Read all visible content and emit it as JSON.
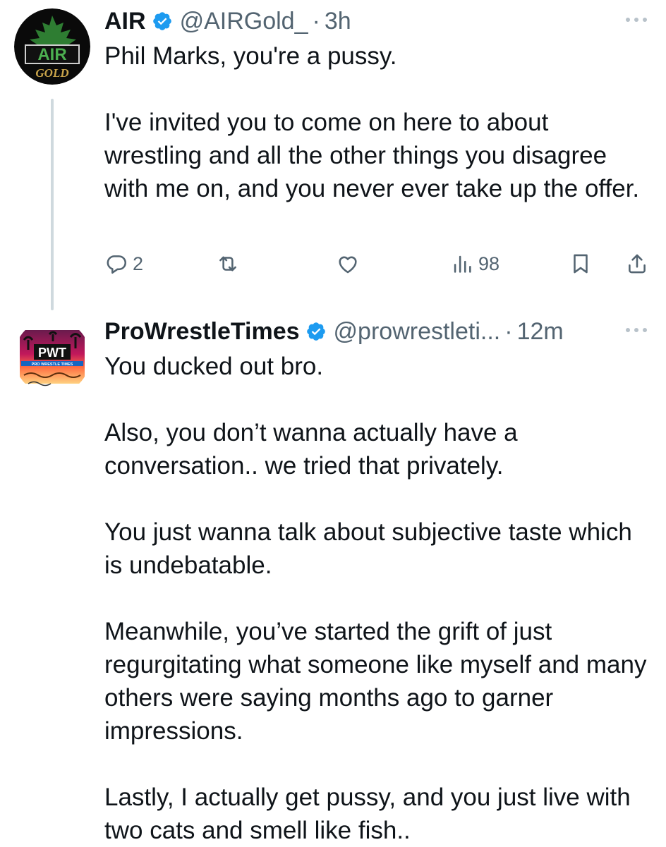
{
  "tweets": [
    {
      "avatar": {
        "top_text": "AIR",
        "bottom_text": "GOLD"
      },
      "name": "AIR",
      "handle": "@AIRGold_",
      "separator": "·",
      "time": "3h",
      "paragraphs": [
        "Phil Marks, you're a pussy.",
        "I've invited you to come on here to about wrestling and all the other things you disagree with me on, and you never ever take up the offer."
      ],
      "actions": {
        "replies": "2",
        "reposts": "",
        "likes": "",
        "views": "98"
      }
    },
    {
      "avatar": {
        "top_text": "PWT",
        "bottom_text": "PRO WRESTLE TIMES"
      },
      "name": "ProWrestleTimes",
      "handle": "@prowrestleti...",
      "separator": "·",
      "time": "12m",
      "paragraphs": [
        "You ducked out bro.",
        "Also, you don’t wanna actually have a conversation.. we tried that privately.",
        "You just wanna talk about subjective taste which is undebatable.",
        "Meanwhile, you’ve started the grift of just regurgitating what someone like myself and many others were saying months ago to garner impressions.",
        "Lastly, I actually get pussy, and you just live with two cats and smell like fish.."
      ]
    }
  ],
  "icons": {
    "verified": "verified-badge-icon",
    "more": "more-dots-icon",
    "reply": "reply-icon",
    "repost": "repost-icon",
    "like": "heart-icon",
    "views": "views-icon",
    "bookmark": "bookmark-icon",
    "share": "share-icon"
  },
  "colors": {
    "text": "#0f1419",
    "secondary": "#536471",
    "verified": "#1d9bf0",
    "thread_line": "#cfd9de"
  }
}
